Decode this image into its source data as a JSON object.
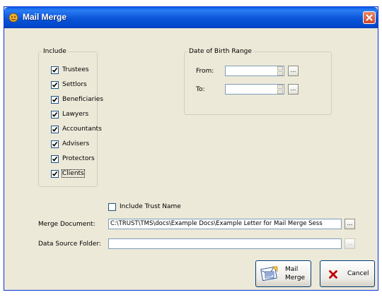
{
  "window": {
    "title": "Mail Merge",
    "app_icon": "mail-merge-app-icon",
    "close_icon": "close-icon"
  },
  "include": {
    "legend": "Include",
    "items": [
      {
        "label": "Trustees",
        "checked": true
      },
      {
        "label": "Settlors",
        "checked": true
      },
      {
        "label": "Beneficiaries",
        "checked": true
      },
      {
        "label": "Lawyers",
        "checked": true
      },
      {
        "label": "Accountants",
        "checked": true
      },
      {
        "label": "Advisers",
        "checked": true
      },
      {
        "label": "Protectors",
        "checked": true
      },
      {
        "label": "Clients",
        "checked": true
      }
    ]
  },
  "dob": {
    "legend": "Date of Birth Range",
    "from_label": "From:",
    "to_label": "To:",
    "from_value": "",
    "to_value": "",
    "browse_label": "..."
  },
  "include_trust_name": {
    "label": "Include Trust Name",
    "checked": false
  },
  "merge_document": {
    "label": "Merge Document:",
    "value": "C:\\TRUST\\TMS\\docs\\Example Docs\\Example Letter for Mail Merge Sess",
    "browse_label": "..."
  },
  "data_source": {
    "label": "Data Source Folder:",
    "value": "",
    "browse_label": "..."
  },
  "buttons": {
    "mail_merge_line1": "Mail",
    "mail_merge_line2": "Merge",
    "mail_merge_icon": "mail-merge-icon",
    "cancel": "Cancel",
    "cancel_icon": "cancel-x-icon"
  },
  "colors": {
    "titlebar": "#0a54d8",
    "dialog_bg": "#ece9d8",
    "cancel_x": "#c00000"
  }
}
